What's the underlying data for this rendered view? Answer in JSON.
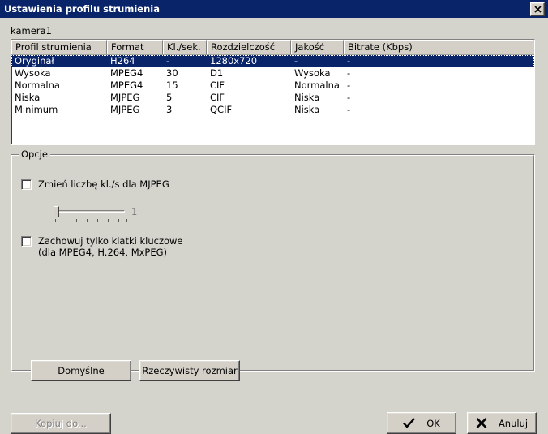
{
  "window": {
    "title": "Ustawienia profilu strumienia",
    "close_icon": "close-icon",
    "camera_label": "kamera1"
  },
  "table": {
    "columns": [
      "Profil strumienia",
      "Format",
      "Kl./sek.",
      "Rozdzielczość",
      "Jakość",
      "Bitrate (Kbps)"
    ],
    "rows": [
      {
        "profil": "Oryginał",
        "format": "H264",
        "klsek": "-",
        "rozdzielczosc": "1280x720",
        "jakosc": "-",
        "bitrate": "-",
        "selected": true
      },
      {
        "profil": "Wysoka",
        "format": "MPEG4",
        "klsek": "30",
        "rozdzielczosc": "D1",
        "jakosc": "Wysoka",
        "bitrate": "-",
        "selected": false
      },
      {
        "profil": "Normalna",
        "format": "MPEG4",
        "klsek": "15",
        "rozdzielczosc": "CIF",
        "jakosc": "Normalna",
        "bitrate": "-",
        "selected": false
      },
      {
        "profil": "Niska",
        "format": "MJPEG",
        "klsek": "5",
        "rozdzielczosc": "CIF",
        "jakosc": "Niska",
        "bitrate": "-",
        "selected": false
      },
      {
        "profil": "Minimum",
        "format": "MJPEG",
        "klsek": "3",
        "rozdzielczosc": "QCIF",
        "jakosc": "Niska",
        "bitrate": "-",
        "selected": false
      }
    ]
  },
  "options": {
    "group_title": "Opcje",
    "checkbox_fps": {
      "label": "Zmień liczbę kl./s dla MJPEG",
      "checked": false
    },
    "slider": {
      "value": "1",
      "min": 1,
      "max": 9,
      "ticks": 8,
      "enabled": false
    },
    "checkbox_keyframes": {
      "label_line1": "Zachowuj tylko klatki kluczowe",
      "label_line2": "(dla MPEG4, H.264, MxPEG)",
      "checked": false
    },
    "defaults_button": "Domyślne",
    "actual_size_button": "Rzeczywisty rozmiar"
  },
  "footer": {
    "copy_to_button": "Kopiuj do...",
    "ok_button": "OK",
    "cancel_button": "Anuluj",
    "ok_icon": "check-icon",
    "cancel_icon": "x-icon"
  },
  "colors": {
    "titlebar": "#0a246a",
    "dialog_bg": "#d4d4cc",
    "button_face": "#d4d0c8",
    "selection": "#0a246a",
    "disabled_text": "#808080"
  }
}
